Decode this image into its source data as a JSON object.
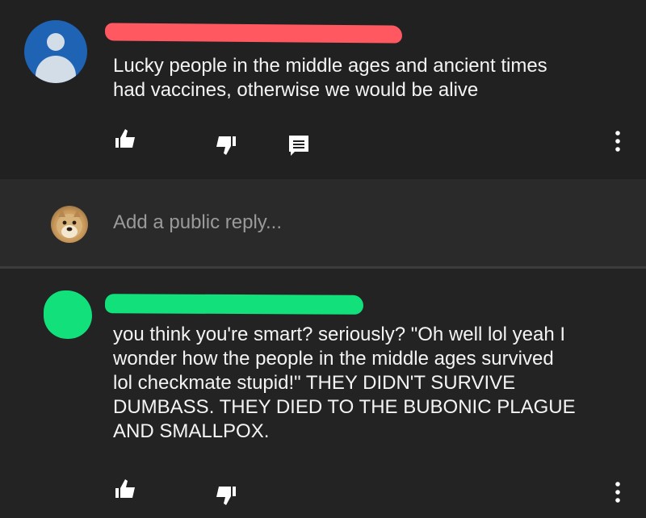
{
  "comment_main": {
    "text": "Lucky people in the middle ages and ancient times\nhad vaccines, otherwise we would be alive"
  },
  "reply_box": {
    "placeholder": "Add a public reply..."
  },
  "comment_reply": {
    "text": "you think you're smart? seriously? \"Oh well lol yeah I\nwonder how the people in the middle ages survived\nlol checkmate stupid!\" THEY DIDN'T SURVIVE\nDUMBASS. THEY DIED TO THE BUBONIC PLAGUE\nAND SMALLPOX."
  },
  "colors": {
    "background": "#232323",
    "redaction_red": "#ff5860",
    "redaction_green": "#11e07b",
    "avatar_blue": "#1f63b4"
  },
  "icons": [
    "like-icon",
    "dislike-icon",
    "reply-icon",
    "more-options-icon"
  ]
}
